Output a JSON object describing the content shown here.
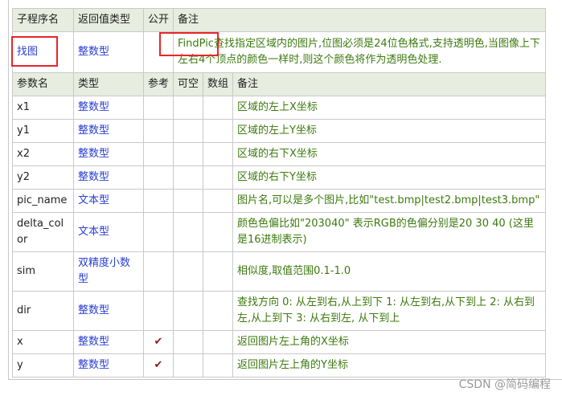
{
  "header1": {
    "col_name": "子程序名",
    "col_return": "返回值类型",
    "col_public": "公开",
    "col_note": "备注"
  },
  "function": {
    "name": "找图",
    "return_type": "整数型",
    "public": "",
    "note": "FindPic查找指定区域内的图片,位图必须是24位色格式,支持透明色,当图像上下左右4个顶点的颜色一样时,则这个颜色将作为透明色处理."
  },
  "header2": {
    "col_param": "参数名",
    "col_type": "类型",
    "col_ref": "参考",
    "col_nullable": "可空",
    "col_array": "数组",
    "col_note": "备注"
  },
  "params": [
    {
      "name": "x1",
      "type": "整数型",
      "ref": "",
      "note": "区域的左上X坐标"
    },
    {
      "name": "y1",
      "type": "整数型",
      "ref": "",
      "note": "区域的左上Y坐标"
    },
    {
      "name": "x2",
      "type": "整数型",
      "ref": "",
      "note": "区域的右下X坐标"
    },
    {
      "name": "y2",
      "type": "整数型",
      "ref": "",
      "note": "区域的右下Y坐标"
    },
    {
      "name": "pic_name",
      "type": "文本型",
      "ref": "",
      "note": "图片名,可以是多个图片,比如\"test.bmp|test2.bmp|test3.bmp\""
    },
    {
      "name": "delta_color",
      "type": "文本型",
      "ref": "",
      "note": "颜色色偏比如\"203040\" 表示RGB的色偏分别是20 30 40 (这里是16进制表示)"
    },
    {
      "name": "sim",
      "type": "双精度小数型",
      "ref": "",
      "note": "相似度,取值范围0.1-1.0"
    },
    {
      "name": "dir",
      "type": "整数型",
      "ref": "",
      "note": "查找方向 0: 从左到右,从上到下 1: 从左到右,从下到上 2: 从右到左,从上到下 3: 从右到左, 从下到上"
    },
    {
      "name": "x",
      "type": "整数型",
      "ref": "✔",
      "note": "返回图片左上角的X坐标"
    },
    {
      "name": "y",
      "type": "整数型",
      "ref": "✔",
      "note": "返回图片左上角的Y坐标"
    }
  ],
  "watermark": "CSDN @简码编程",
  "colors": {
    "header_bg": "#e7eddf",
    "link_blue": "#2a3fd4",
    "note_green": "#3c7a0e",
    "highlight_red": "#e8262a",
    "check_red": "#8b1a1a"
  }
}
